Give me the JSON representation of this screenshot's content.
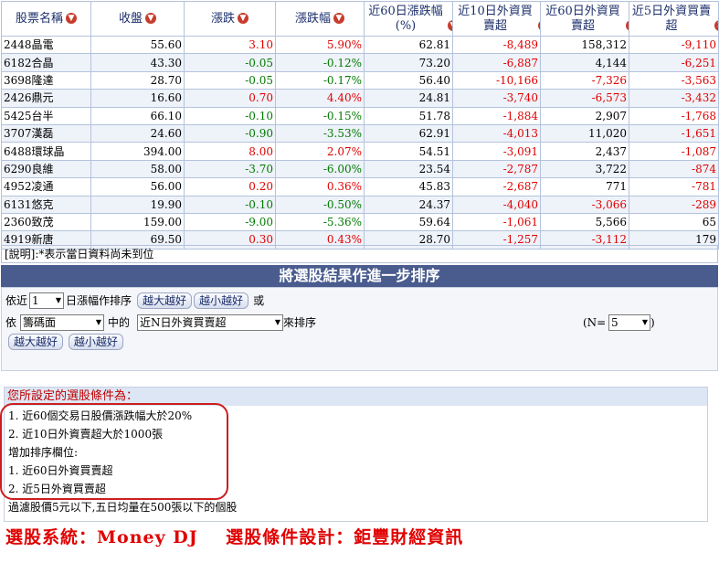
{
  "headers": [
    {
      "label": "股票名稱",
      "icons": [
        "sort"
      ]
    },
    {
      "label": "收盤",
      "icons": [
        "sort"
      ]
    },
    {
      "label": "漲跌",
      "icons": [
        "sort"
      ]
    },
    {
      "label": "漲跌幅",
      "icons": [
        "sort"
      ]
    },
    {
      "label": "近60日漲跌幅(%)",
      "icons": [
        "sort"
      ]
    },
    {
      "label": "近10日外資買賣超",
      "icons": [
        "sort"
      ]
    },
    {
      "label": "近60日外資買賣超",
      "icons": [
        "remove",
        "sort"
      ]
    },
    {
      "label": "近5日外資買賣超",
      "icons": [
        "remove",
        "sort"
      ]
    }
  ],
  "rows": [
    [
      "2448晶電",
      "55.60",
      "3.10",
      "5.90%",
      "62.81",
      "-8,489",
      "158,312",
      "-9,110"
    ],
    [
      "6182合晶",
      "43.30",
      "-0.05",
      "-0.12%",
      "73.20",
      "-6,887",
      "4,144",
      "-6,251"
    ],
    [
      "3698隆達",
      "28.70",
      "-0.05",
      "-0.17%",
      "56.40",
      "-10,166",
      "-7,326",
      "-3,563"
    ],
    [
      "2426鼎元",
      "16.60",
      "0.70",
      "4.40%",
      "24.81",
      "-3,740",
      "-6,573",
      "-3,432"
    ],
    [
      "5425台半",
      "66.10",
      "-0.10",
      "-0.15%",
      "51.78",
      "-1,884",
      "2,907",
      "-1,768"
    ],
    [
      "3707漢磊",
      "24.60",
      "-0.90",
      "-3.53%",
      "62.91",
      "-4,013",
      "11,020",
      "-1,651"
    ],
    [
      "6488環球晶",
      "394.00",
      "8.00",
      "2.07%",
      "54.51",
      "-3,091",
      "2,437",
      "-1,087"
    ],
    [
      "6290良維",
      "58.00",
      "-3.70",
      "-6.00%",
      "23.54",
      "-2,787",
      "3,722",
      "-874"
    ],
    [
      "4952凌通",
      "56.00",
      "0.20",
      "0.36%",
      "45.83",
      "-2,687",
      "771",
      "-781"
    ],
    [
      "6131悠克",
      "19.90",
      "-0.10",
      "-0.50%",
      "24.37",
      "-4,040",
      "-3,066",
      "-289"
    ],
    [
      "2360致茂",
      "159.00",
      "-9.00",
      "-5.36%",
      "59.64",
      "-1,061",
      "5,566",
      "65"
    ],
    [
      "4919新唐",
      "69.50",
      "0.30",
      "0.43%",
      "28.70",
      "-1,257",
      "-3,112",
      "179"
    ]
  ],
  "note": "[說明]:*表示當日資料尚未到位",
  "sort_title": "將選股結果作進一步排序",
  "sort": {
    "prefix_days": "依近",
    "days_value": "1",
    "days_suffix": "日漲幅作排序",
    "btn_desc": "越大越好",
    "btn_asc": "越小越好",
    "or": "或",
    "by": "依",
    "category_value": "籌碼面",
    "mid": "中的",
    "field_value": "近N日外資買賣超",
    "suffix_sort": "來排序",
    "n_label": "(N=",
    "n_value": "5",
    "n_close": ")"
  },
  "conditions": {
    "title": "您所設定的選股條件為：",
    "lines": [
      "1.  近60個交易日股價漲跌幅大於20%",
      "2.  近10日外資賣超大於1000張",
      "增加排序欄位:",
      "1.  近60日外資買賣超",
      "2.  近5日外資買賣超",
      "過濾股價5元以下,五日均量在500張以下的個股"
    ]
  },
  "footer": "選股系統：Money DJ    選股條件設計：鉅豐財經資訊",
  "colors": {
    "up": "#e00000",
    "down": "#007a00",
    "bar": "#4a5c8e",
    "highlight": "#cc1e1e"
  }
}
